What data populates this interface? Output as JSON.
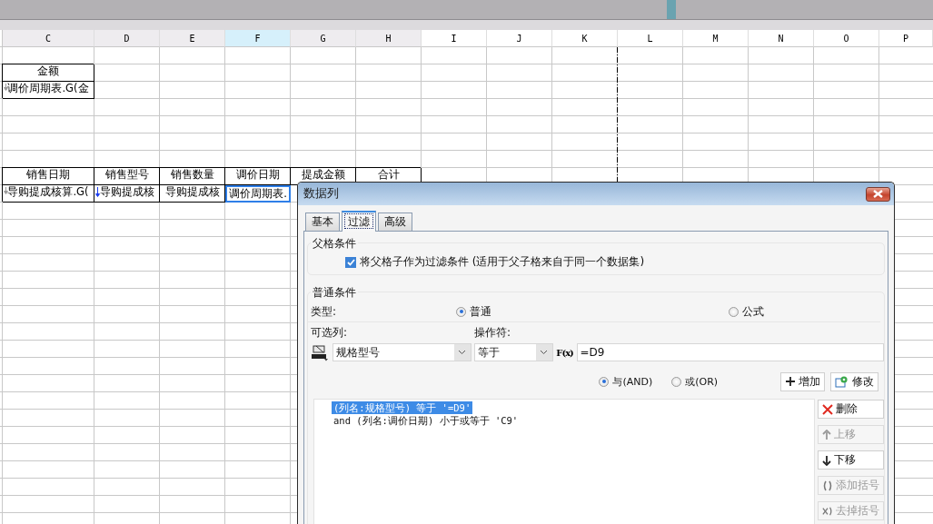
{
  "sheet": {
    "columns": [
      {
        "label": "C",
        "selected": false,
        "used": true,
        "page_break_after": false
      },
      {
        "label": "D",
        "selected": false,
        "used": true,
        "page_break_after": false
      },
      {
        "label": "E",
        "selected": false,
        "used": true,
        "page_break_after": false
      },
      {
        "label": "F",
        "selected": true,
        "used": true,
        "page_break_after": false
      },
      {
        "label": "G",
        "selected": false,
        "used": true,
        "page_break_after": false
      },
      {
        "label": "H",
        "selected": false,
        "used": true,
        "page_break_after": false
      },
      {
        "label": "I",
        "selected": false,
        "used": false,
        "page_break_after": false
      },
      {
        "label": "J",
        "selected": false,
        "used": false,
        "page_break_after": false
      },
      {
        "label": "K",
        "selected": false,
        "used": false,
        "page_break_after": true
      },
      {
        "label": "L",
        "selected": false,
        "used": false,
        "page_break_after": false
      },
      {
        "label": "M",
        "selected": false,
        "used": false,
        "page_break_after": false
      },
      {
        "label": "N",
        "selected": false,
        "used": false,
        "page_break_after": false
      },
      {
        "label": "O",
        "selected": false,
        "used": false,
        "page_break_after": false
      },
      {
        "label": "P",
        "selected": false,
        "used": false,
        "page_break_after": false
      }
    ],
    "rows": [
      {
        "kind": "blank"
      },
      {
        "kind": "filled",
        "cells": [
          {
            "text": "金额",
            "selected": false,
            "kind": "plain"
          }
        ]
      },
      {
        "kind": "filled",
        "cells": [
          {
            "text": "调价周期表.G(金",
            "selected": false,
            "kind": "expanding"
          }
        ]
      },
      {
        "kind": "blank"
      },
      {
        "kind": "blank"
      },
      {
        "kind": "blank"
      },
      {
        "kind": "blank"
      },
      {
        "kind": "filled",
        "cells": [
          {
            "text": "销售日期",
            "selected": false,
            "kind": "plain"
          },
          {
            "text": "销售型号",
            "selected": false,
            "kind": "plain"
          },
          {
            "text": "销售数量",
            "selected": false,
            "kind": "plain"
          },
          {
            "text": "调价日期",
            "selected": false,
            "kind": "plain"
          },
          {
            "text": "提成金额",
            "selected": false,
            "kind": "plain"
          },
          {
            "text": "合计",
            "selected": false,
            "kind": "plain"
          }
        ]
      },
      {
        "kind": "filled",
        "cells": [
          {
            "text": "导购提成核算.G(",
            "selected": false,
            "kind": "expanding"
          },
          {
            "text": "导购提成核",
            "selected": false,
            "kind": "expanding-active"
          },
          {
            "text": "导购提成核",
            "selected": false,
            "kind": "plain"
          },
          {
            "text": "调价周期表.",
            "selected": true,
            "kind": "plain"
          }
        ]
      }
    ]
  },
  "dialog": {
    "title": "数据列",
    "tabs": [
      {
        "label": "基本",
        "selected": false
      },
      {
        "label": "过滤",
        "selected": true
      },
      {
        "label": "高级",
        "selected": false
      }
    ],
    "parent_group": {
      "legend": "父格条件",
      "checkbox": {
        "label": "将父格子作为过滤条件 (适用于父子格来自于同一个数据集)",
        "checked": true
      }
    },
    "normal_group": {
      "legend": "普通条件",
      "type_label": "类型:",
      "type_options": [
        {
          "label": "普通",
          "selected": true
        },
        {
          "label": "公式",
          "selected": false
        }
      ],
      "column_label": "可选列:",
      "operator_label": "操作符:",
      "column_value": "规格型号",
      "operator_value": "等于",
      "formula_button": "F(x)",
      "formula_value": "=D9",
      "logic_options": [
        {
          "label": "与(AND)",
          "selected": true
        },
        {
          "label": "或(OR)",
          "selected": false
        }
      ],
      "actions": [
        {
          "label": "增加",
          "kind": "add"
        },
        {
          "label": "修改",
          "kind": "edit"
        }
      ],
      "conditions": [
        {
          "text": "(列名:规格型号) 等于 '=D9'",
          "selected": true
        },
        {
          "text": "and (列名:调价日期) 小于或等于 'C9'",
          "selected": false
        }
      ],
      "side_buttons": [
        {
          "label": "删除",
          "kind": "delete",
          "disabled": false
        },
        {
          "label": "上移",
          "kind": "up",
          "disabled": true
        },
        {
          "label": "下移",
          "kind": "down",
          "disabled": false
        },
        {
          "label": "添加括号",
          "kind": "add-bracket",
          "disabled": true
        },
        {
          "label": "去掉括号",
          "kind": "remove-bracket",
          "disabled": true
        }
      ]
    }
  }
}
